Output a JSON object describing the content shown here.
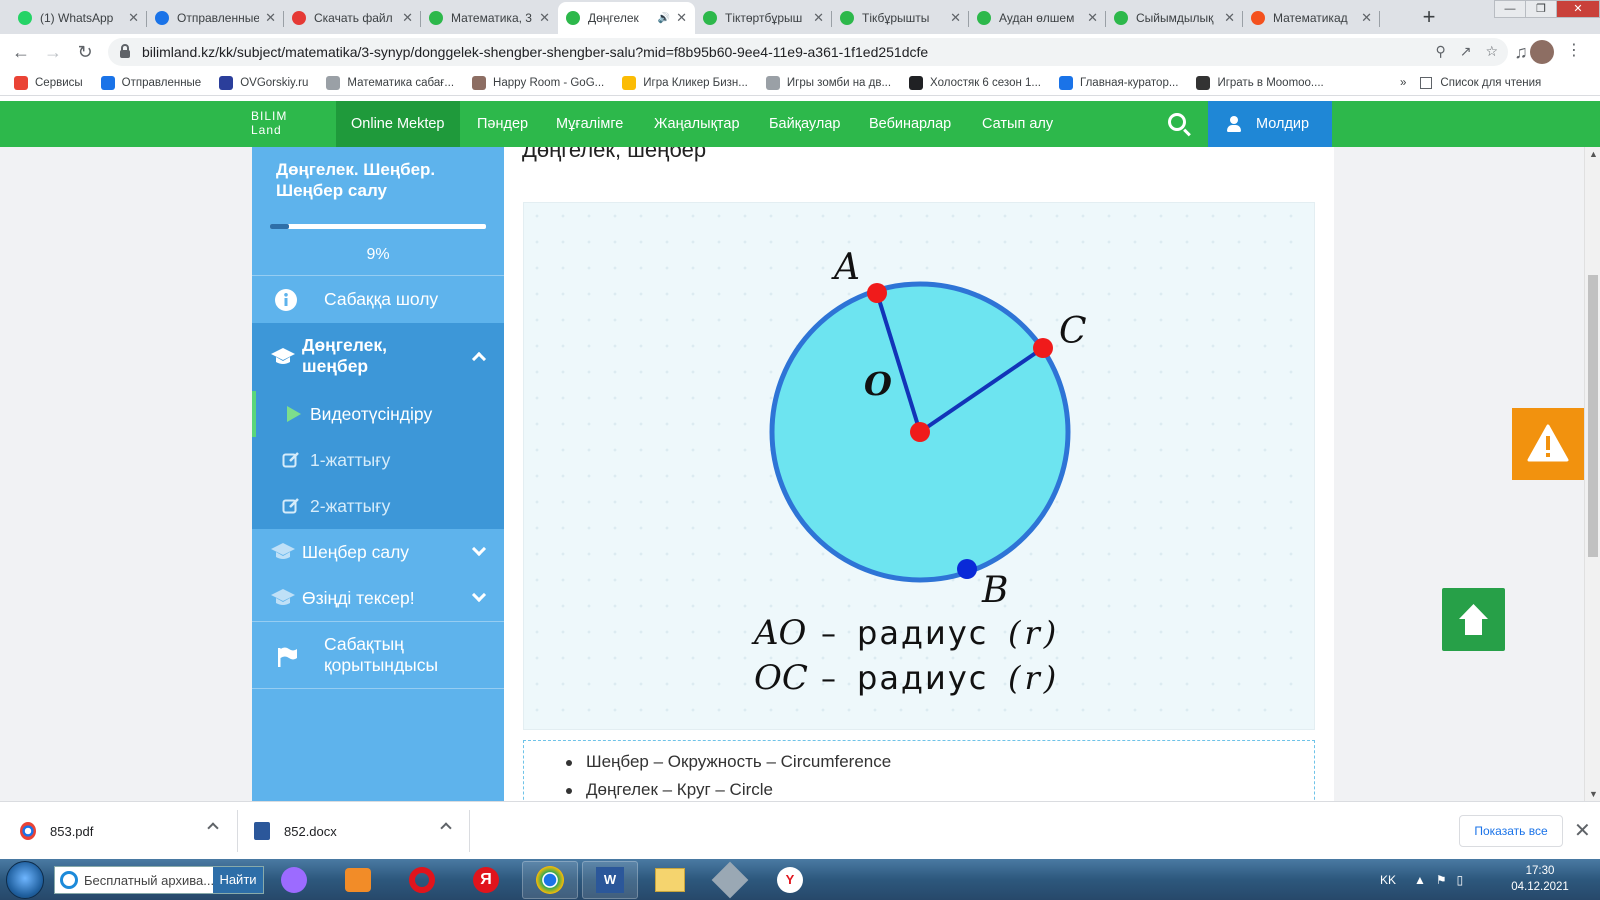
{
  "browser": {
    "tabs": [
      {
        "title": "(1) WhatsApp",
        "icon": "whatsapp-icon",
        "color": "#25d366"
      },
      {
        "title": "Отправленные",
        "icon": "mail-icon",
        "color": "#1a73e8"
      },
      {
        "title": "Скачать файл",
        "icon": "heart-icon",
        "color": "#e53935"
      },
      {
        "title": "Математика, 3",
        "icon": "bilimland-icon",
        "color": "#2db84b"
      },
      {
        "title": "Дөңгелек",
        "icon": "bilimland-icon",
        "color": "#2db84b",
        "active": true,
        "audio": true
      },
      {
        "title": "Тіктөртбұрыш",
        "icon": "bilimland-icon",
        "color": "#2db84b"
      },
      {
        "title": "Тікбұрышты",
        "icon": "bilimland-icon",
        "color": "#2db84b"
      },
      {
        "title": "Аудан өлшем",
        "icon": "bilimland-icon",
        "color": "#2db84b"
      },
      {
        "title": "Сыйымдылық",
        "icon": "bilimland-icon",
        "color": "#2db84b"
      },
      {
        "title": "Математикад",
        "icon": "play-icon",
        "color": "#f4511e"
      }
    ],
    "new_tab": "+",
    "url": "bilimland.kz/kk/subject/matematika/3-synyp/donggelek-shengber-shengber-salu?mid=f8b95b60-9ee4-11e9-a361-1f1ed251dcfe",
    "bookmarks": [
      {
        "label": "Сервисы",
        "color": "#ea4335"
      },
      {
        "label": "Отправленные",
        "color": "#1a73e8"
      },
      {
        "label": "OVGorskiy.ru",
        "color": "#2b3e9b"
      },
      {
        "label": "Математика сабағ...",
        "color": "#9aa0a6"
      },
      {
        "label": "Happy Room - GoG...",
        "color": "#8d6e63"
      },
      {
        "label": "Игра Кликер Бизн...",
        "color": "#fbbc05"
      },
      {
        "label": "Игры зомби на дв...",
        "color": "#9aa0a6"
      },
      {
        "label": "Холостяк 6 сезон 1...",
        "color": "#202124"
      },
      {
        "label": "Главная-куратор...",
        "color": "#1a73e8"
      },
      {
        "label": "Играть в Moomoo....",
        "color": "#333333"
      }
    ],
    "bookmarks_more": "»",
    "reading_list": "Список для чтения"
  },
  "site": {
    "logo_line1": "BILIM",
    "logo_line2": "Land",
    "nav": [
      "Online Mektep",
      "Пәндер",
      "Мұғалімге",
      "Жаңалықтар",
      "Байқаулар",
      "Вебинарлар",
      "Сатып алу"
    ],
    "user": "Молдир",
    "colors": {
      "brand": "#2db84b",
      "user": "#1f87d6",
      "sidebar": "#5eb3ec"
    }
  },
  "sidebar": {
    "title": "Дөңгелек. Шеңбер. Шеңбер салу",
    "progress_percent": 9,
    "progress_label": "9%",
    "items": [
      {
        "label": "Сабаққа шолу",
        "icon": "info-icon"
      },
      {
        "label": "Дөңгелек, шеңбер",
        "icon": "graduation-cap-icon",
        "expanded": true
      },
      {
        "label": "Видеотүсіндіру",
        "icon": "play-icon",
        "sub": true,
        "active": true
      },
      {
        "label": "1-жаттығу",
        "icon": "edit-icon",
        "sub": true
      },
      {
        "label": "2-жаттығу",
        "icon": "edit-icon",
        "sub": true
      },
      {
        "label": "Шеңбер салу",
        "icon": "graduation-cap-icon"
      },
      {
        "label": "Өзіңді тексер!",
        "icon": "graduation-cap-icon"
      },
      {
        "label": "Сабақтың қорытындысы",
        "icon": "flag-icon"
      }
    ]
  },
  "content": {
    "section_title": "Дөңгелек, шеңбер",
    "figure": {
      "point_a": "A",
      "point_b": "B",
      "point_c": "C",
      "center": "O",
      "line1_left": "AO",
      "line1_right": "радиус",
      "line1_paren": "(r)",
      "line2_left": "OC",
      "line2_right": "радиус",
      "line2_paren": "(r)",
      "dash": "–"
    },
    "glossary": [
      "Шеңбер – Окружность – Circumference",
      "Дөңгелек – Круг – Circle"
    ]
  },
  "downloads": {
    "items": [
      {
        "name": "853.pdf"
      },
      {
        "name": "852.docx"
      }
    ],
    "show_all": "Показать все"
  },
  "taskbar": {
    "search_placeholder": "Бесплатный архива...",
    "search_button": "Найти",
    "lang": "KK",
    "time": "17:30",
    "date": "04.12.2021"
  }
}
